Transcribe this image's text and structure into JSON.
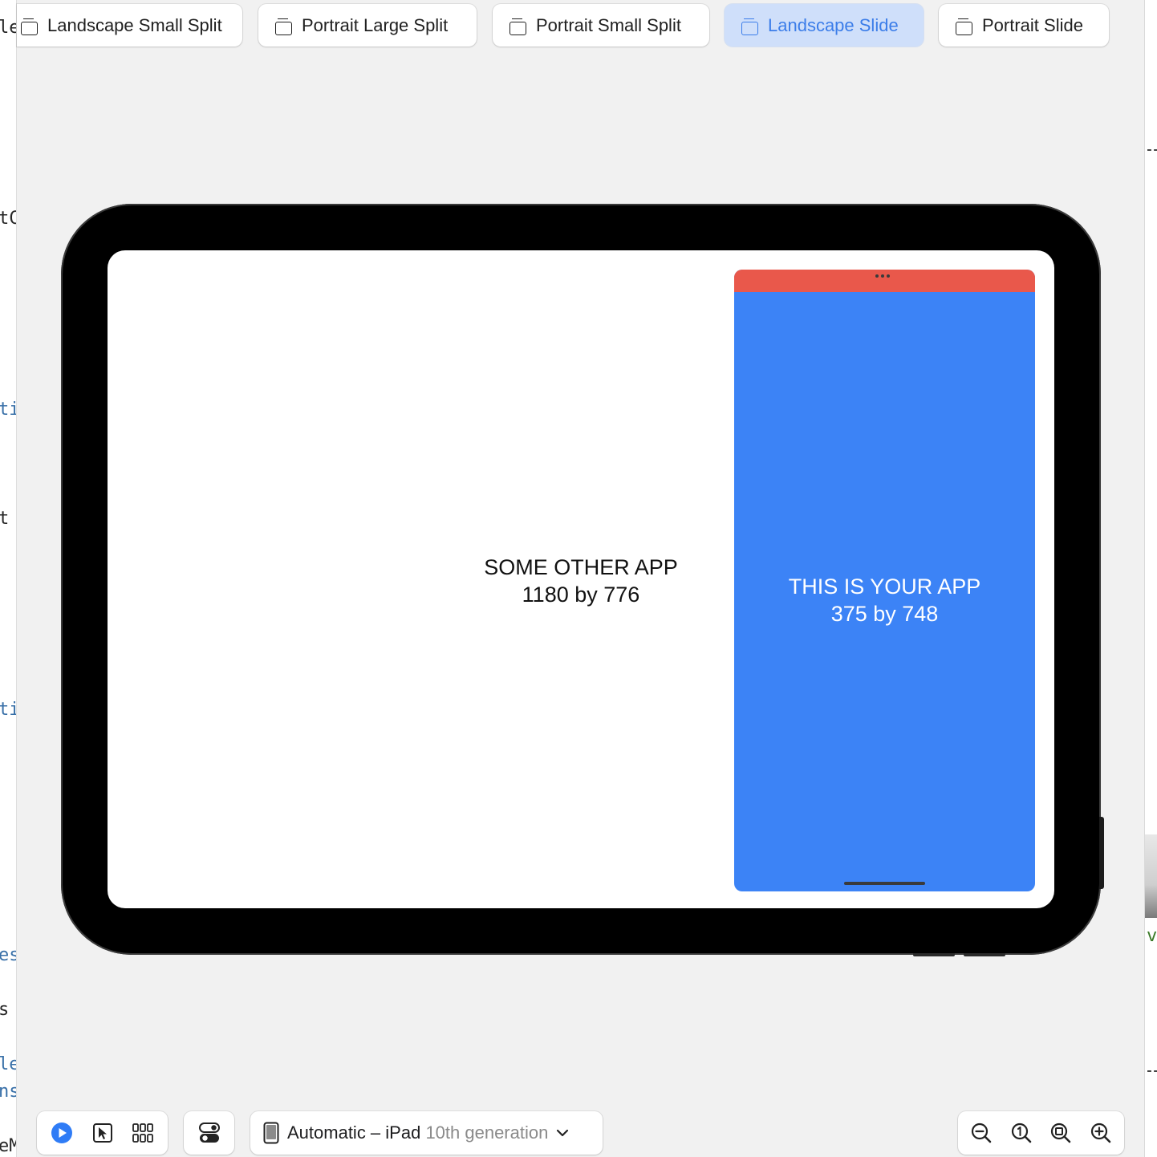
{
  "presets": [
    {
      "label": "Landscape Small Split",
      "active": false
    },
    {
      "label": "Portrait Large Split",
      "active": false
    },
    {
      "label": "Portrait Small Split",
      "active": false
    },
    {
      "label": "Landscape Slide",
      "active": true
    },
    {
      "label": "Portrait Slide",
      "active": false
    }
  ],
  "code_fragments": {
    "f1": "le",
    "f2": "tC",
    "f3": "ti",
    "f4": "t",
    "f5": "ti",
    "f6": "es",
    "f7": "s",
    "f8": "le",
    "f9": "ns",
    "f10": "eM",
    "right": "ve"
  },
  "other_app": {
    "title": "SOME OTHER APP",
    "size": "1180 by 776"
  },
  "your_app": {
    "title": "THIS IS YOUR APP",
    "size": "375 by 748"
  },
  "colors": {
    "slide_over": "#3c83f6",
    "slide_bar": "#e9584b",
    "accent": "#3b7de9"
  },
  "toolbar": {
    "device_name": "Automatic – iPad",
    "device_model": "10th generation",
    "icons": [
      "live-preview-icon",
      "selectable-preview-icon",
      "variants-grid-icon",
      "device-settings-icon",
      "zoom-out-icon",
      "zoom-actual-icon",
      "zoom-fit-icon",
      "zoom-in-icon"
    ]
  }
}
